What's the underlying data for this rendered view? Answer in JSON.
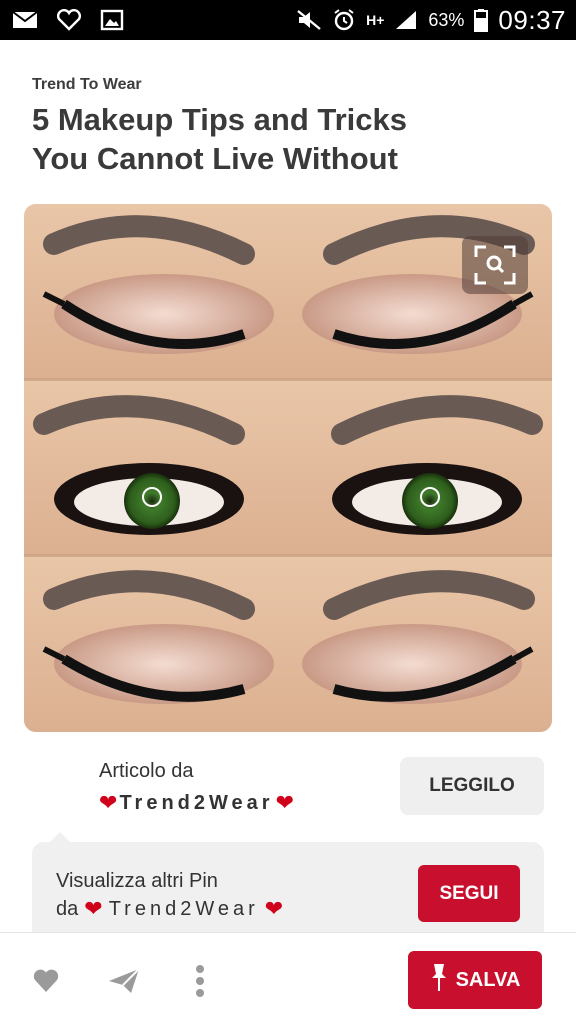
{
  "status_bar": {
    "battery_percent": "63%",
    "time": "09:37",
    "network": "H+",
    "left_icons": [
      "mail-icon",
      "heart-outline-icon",
      "image-icon"
    ],
    "right_icons": [
      "mute-icon",
      "alarm-icon",
      "signal-icon",
      "battery-icon"
    ]
  },
  "article": {
    "source": "Trend To Wear",
    "title_line1": "5 Makeup Tips and Tricks",
    "title_line2": "You Cannot Live Without"
  },
  "image": {
    "visual_search_icon": "visual-search-icon"
  },
  "attribution": {
    "label": "Articolo da",
    "brand": "Trend2Wear",
    "read_button": "LEGGILO"
  },
  "follow": {
    "line1": "Visualizza altri Pin",
    "line2_prefix": "da",
    "brand": "Trend2Wear",
    "follow_button": "SEGUI"
  },
  "actions": {
    "save_button": "SALVA",
    "icons": [
      "heart-icon",
      "send-icon",
      "more-icon",
      "pin-icon"
    ]
  },
  "colors": {
    "accent": "#c8102e",
    "heart": "#d0021b"
  }
}
